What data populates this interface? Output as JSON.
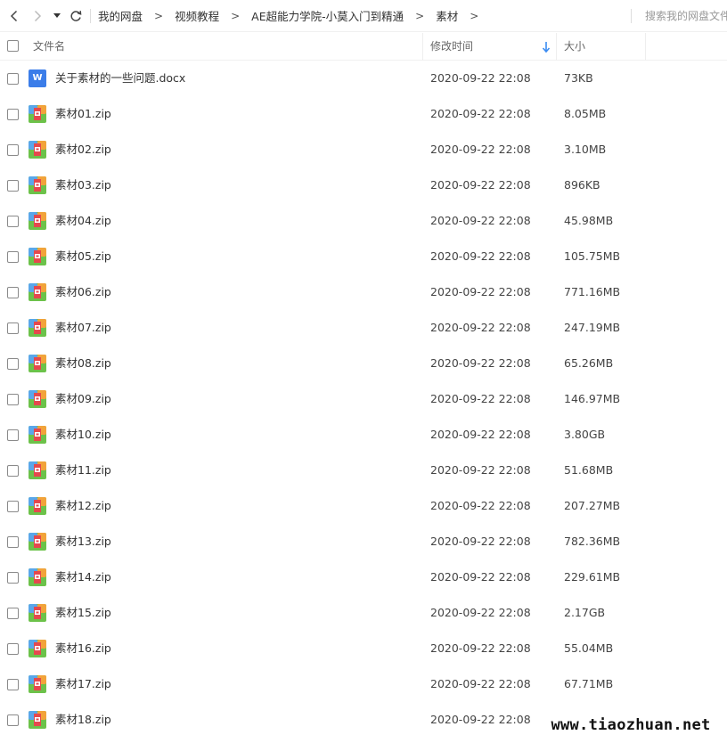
{
  "toolbar": {
    "back_icon": "chevron-left-icon",
    "forward_icon": "chevron-right-icon",
    "dropdown_icon": "caret-down-icon",
    "refresh_icon": "refresh-icon"
  },
  "breadcrumb": [
    "我的网盘",
    "视频教程",
    "AE超能力学院-小莫入门到精通",
    "素材"
  ],
  "breadcrumb_separator": ">",
  "search": {
    "placeholder": "搜索我的网盘文件"
  },
  "columns": {
    "name": "文件名",
    "mtime": "修改时间",
    "size": "大小"
  },
  "sort": {
    "column": "mtime",
    "direction": "desc",
    "color": "#3b8cf2"
  },
  "colors": {
    "doc_icon": "#3b7de9",
    "zip_blue": "#5aa7ea",
    "zip_orange": "#f2a33a",
    "zip_green": "#6cc24a",
    "zip_red": "#e5484d"
  },
  "files": [
    {
      "name": "关于素材的一些问题.docx",
      "type": "docx",
      "icon_letter": "W",
      "mtime": "2020-09-22 22:08",
      "size": "73KB"
    },
    {
      "name": "素材01.zip",
      "type": "zip",
      "mtime": "2020-09-22 22:08",
      "size": "8.05MB"
    },
    {
      "name": "素材02.zip",
      "type": "zip",
      "mtime": "2020-09-22 22:08",
      "size": "3.10MB"
    },
    {
      "name": "素材03.zip",
      "type": "zip",
      "mtime": "2020-09-22 22:08",
      "size": "896KB"
    },
    {
      "name": "素材04.zip",
      "type": "zip",
      "mtime": "2020-09-22 22:08",
      "size": "45.98MB"
    },
    {
      "name": "素材05.zip",
      "type": "zip",
      "mtime": "2020-09-22 22:08",
      "size": "105.75MB"
    },
    {
      "name": "素材06.zip",
      "type": "zip",
      "mtime": "2020-09-22 22:08",
      "size": "771.16MB"
    },
    {
      "name": "素材07.zip",
      "type": "zip",
      "mtime": "2020-09-22 22:08",
      "size": "247.19MB"
    },
    {
      "name": "素材08.zip",
      "type": "zip",
      "mtime": "2020-09-22 22:08",
      "size": "65.26MB"
    },
    {
      "name": "素材09.zip",
      "type": "zip",
      "mtime": "2020-09-22 22:08",
      "size": "146.97MB"
    },
    {
      "name": "素材10.zip",
      "type": "zip",
      "mtime": "2020-09-22 22:08",
      "size": "3.80GB"
    },
    {
      "name": "素材11.zip",
      "type": "zip",
      "mtime": "2020-09-22 22:08",
      "size": "51.68MB"
    },
    {
      "name": "素材12.zip",
      "type": "zip",
      "mtime": "2020-09-22 22:08",
      "size": "207.27MB"
    },
    {
      "name": "素材13.zip",
      "type": "zip",
      "mtime": "2020-09-22 22:08",
      "size": "782.36MB"
    },
    {
      "name": "素材14.zip",
      "type": "zip",
      "mtime": "2020-09-22 22:08",
      "size": "229.61MB"
    },
    {
      "name": "素材15.zip",
      "type": "zip",
      "mtime": "2020-09-22 22:08",
      "size": "2.17GB"
    },
    {
      "name": "素材16.zip",
      "type": "zip",
      "mtime": "2020-09-22 22:08",
      "size": "55.04MB"
    },
    {
      "name": "素材17.zip",
      "type": "zip",
      "mtime": "2020-09-22 22:08",
      "size": "67.71MB"
    },
    {
      "name": "素材18.zip",
      "type": "zip",
      "mtime": "2020-09-22 22:08",
      "size": ""
    }
  ],
  "watermark": "www.tiaozhuan.net"
}
